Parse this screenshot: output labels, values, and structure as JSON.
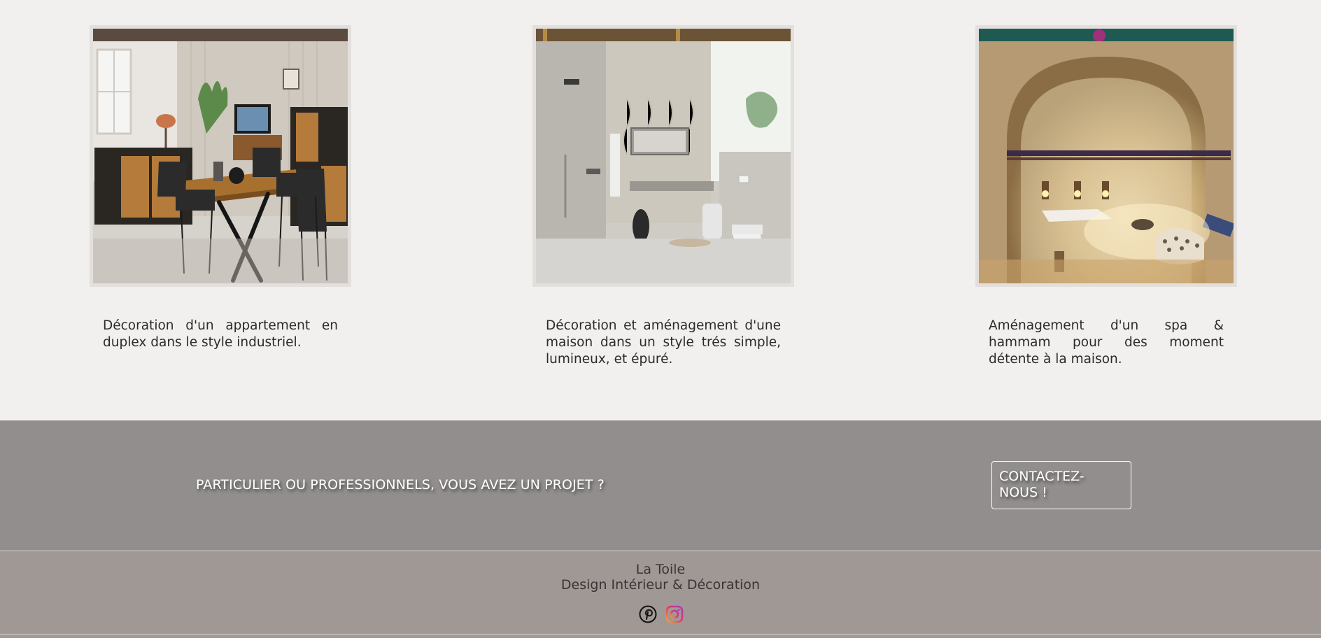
{
  "projects": [
    {
      "image": "industrial-duplex-dining-room",
      "description": "Décoration d'un appartement en duplex dans le style industriel."
    },
    {
      "image": "minimalist-bathroom",
      "description": "Décoration et aménagement d'une maison dans un style trés simple, lumineux, et épuré."
    },
    {
      "image": "spa-hammam-vaulted-room",
      "description": "Aménagement d'un spa & hammam pour des moment détente à la maison."
    }
  ],
  "cta": {
    "text": "PARTICULIER OU PROFESSIONNELS, VOUS AVEZ UN PROJET ?",
    "button_label_line1": "CONTACTEZ-",
    "button_label_line2": "NOUS !"
  },
  "footer": {
    "brand_name": "La Toile",
    "brand_tagline": "Design Intérieur & Décoration",
    "social": [
      {
        "name": "pinterest-icon"
      },
      {
        "name": "instagram-icon"
      }
    ]
  },
  "colors": {
    "page_bg": "#f2f0ee",
    "cta_band": "#928e8e",
    "footer_bg": "#a09895",
    "text_dark": "#2c2a2a"
  }
}
